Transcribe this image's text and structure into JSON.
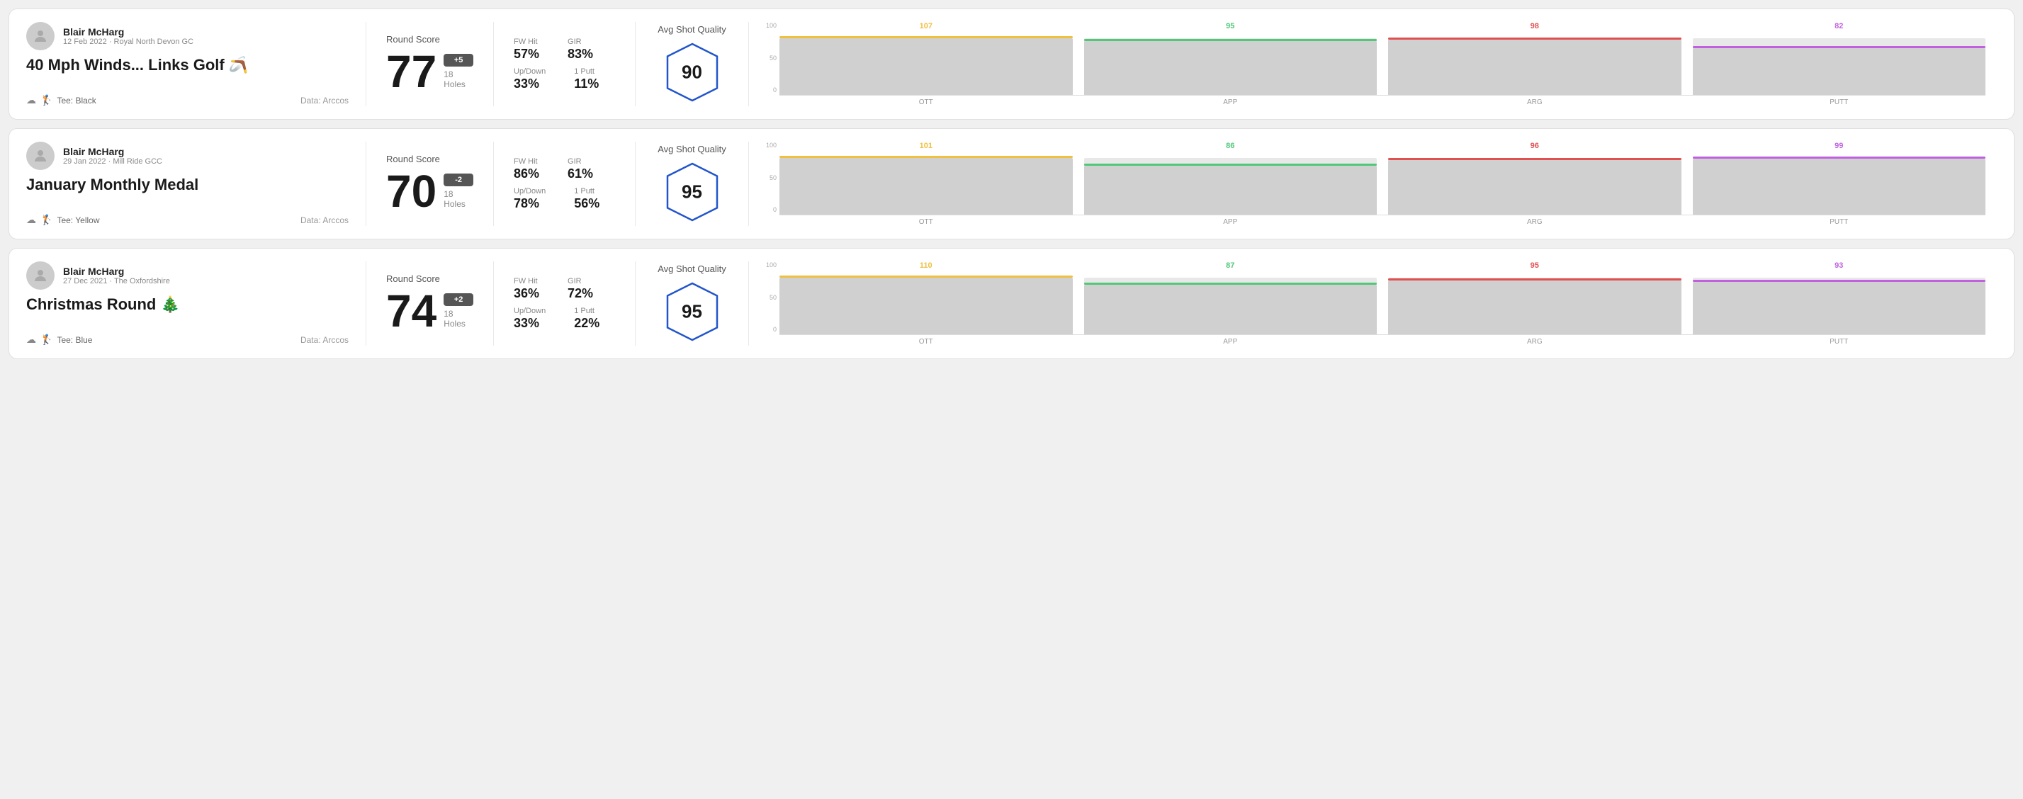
{
  "rounds": [
    {
      "id": "round1",
      "player": "Blair McHarg",
      "date": "12 Feb 2022 · Royal North Devon GC",
      "title": "40 Mph Winds... Links Golf 🪃",
      "tee": "Tee: Black",
      "data_source": "Data: Arccos",
      "score": "77",
      "score_diff": "+5",
      "holes": "18 Holes",
      "fw_hit": "57%",
      "gir": "83%",
      "up_down": "33%",
      "one_putt": "11%",
      "avg_shot_quality": "90",
      "chart": {
        "columns": [
          {
            "label": "OTT",
            "value": 107,
            "color": "#f0c040"
          },
          {
            "label": "APP",
            "value": 95,
            "color": "#50c878"
          },
          {
            "label": "ARG",
            "value": 98,
            "color": "#e05050"
          },
          {
            "label": "PUTT",
            "value": 82,
            "color": "#c060e0"
          }
        ]
      }
    },
    {
      "id": "round2",
      "player": "Blair McHarg",
      "date": "29 Jan 2022 · Mill Ride GCC",
      "title": "January Monthly Medal",
      "tee": "Tee: Yellow",
      "data_source": "Data: Arccos",
      "score": "70",
      "score_diff": "-2",
      "holes": "18 Holes",
      "fw_hit": "86%",
      "gir": "61%",
      "up_down": "78%",
      "one_putt": "56%",
      "avg_shot_quality": "95",
      "chart": {
        "columns": [
          {
            "label": "OTT",
            "value": 101,
            "color": "#f0c040"
          },
          {
            "label": "APP",
            "value": 86,
            "color": "#50c878"
          },
          {
            "label": "ARG",
            "value": 96,
            "color": "#e05050"
          },
          {
            "label": "PUTT",
            "value": 99,
            "color": "#c060e0"
          }
        ]
      }
    },
    {
      "id": "round3",
      "player": "Blair McHarg",
      "date": "27 Dec 2021 · The Oxfordshire",
      "title": "Christmas Round 🎄",
      "tee": "Tee: Blue",
      "data_source": "Data: Arccos",
      "score": "74",
      "score_diff": "+2",
      "holes": "18 Holes",
      "fw_hit": "36%",
      "gir": "72%",
      "up_down": "33%",
      "one_putt": "22%",
      "avg_shot_quality": "95",
      "chart": {
        "columns": [
          {
            "label": "OTT",
            "value": 110,
            "color": "#f0c040"
          },
          {
            "label": "APP",
            "value": 87,
            "color": "#50c878"
          },
          {
            "label": "ARG",
            "value": 95,
            "color": "#e05050"
          },
          {
            "label": "PUTT",
            "value": 93,
            "color": "#c060e0"
          }
        ]
      }
    }
  ],
  "labels": {
    "round_score": "Round Score",
    "fw_hit": "FW Hit",
    "gir": "GIR",
    "up_down": "Up/Down",
    "one_putt": "1 Putt",
    "avg_shot_quality": "Avg Shot Quality",
    "y_axis": [
      "100",
      "50",
      "0"
    ]
  }
}
